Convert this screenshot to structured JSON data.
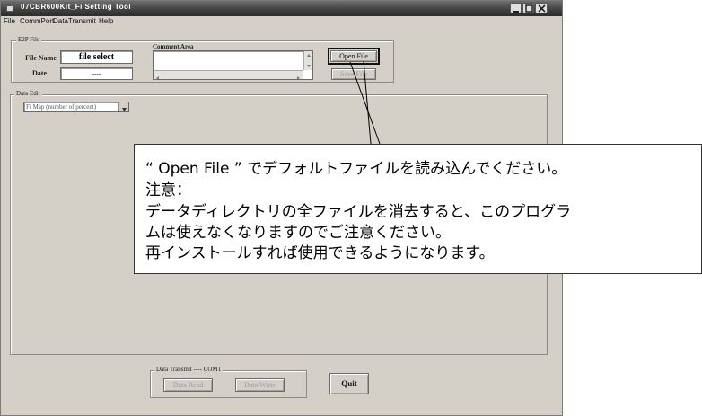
{
  "window": {
    "title": "07CBR600Kit_Fi Setting Tool",
    "menu": [
      "File",
      "CommPort",
      "DataTransmit",
      "Help"
    ]
  },
  "e2p_file": {
    "legend": "E2P File",
    "file_name_label": "File Name",
    "file_name_value": "file select",
    "date_label": "Date",
    "date_value": "----"
  },
  "comment_area": {
    "label": "Comment Area",
    "value": ""
  },
  "buttons": {
    "open_file": "Open File",
    "save_file": "Save File",
    "quit": "Quit"
  },
  "data_edit": {
    "legend": "Data Edit",
    "map_select_value": "Fi Map (number of percent)"
  },
  "data_transmit": {
    "legend": "Data Transmit ---- COM1",
    "read_label": "Data Read",
    "write_label": "Data Write"
  },
  "callout": {
    "lines": [
      "“ Open File ” でデフォルトファイルを読み込んでください。",
      "注意：",
      "データディレクトリの全ファイルを消去すると、このプログラ",
      "ムは使えなくなりますのでご注意ください。",
      "再インストールすれば使用できるようになります。"
    ]
  }
}
